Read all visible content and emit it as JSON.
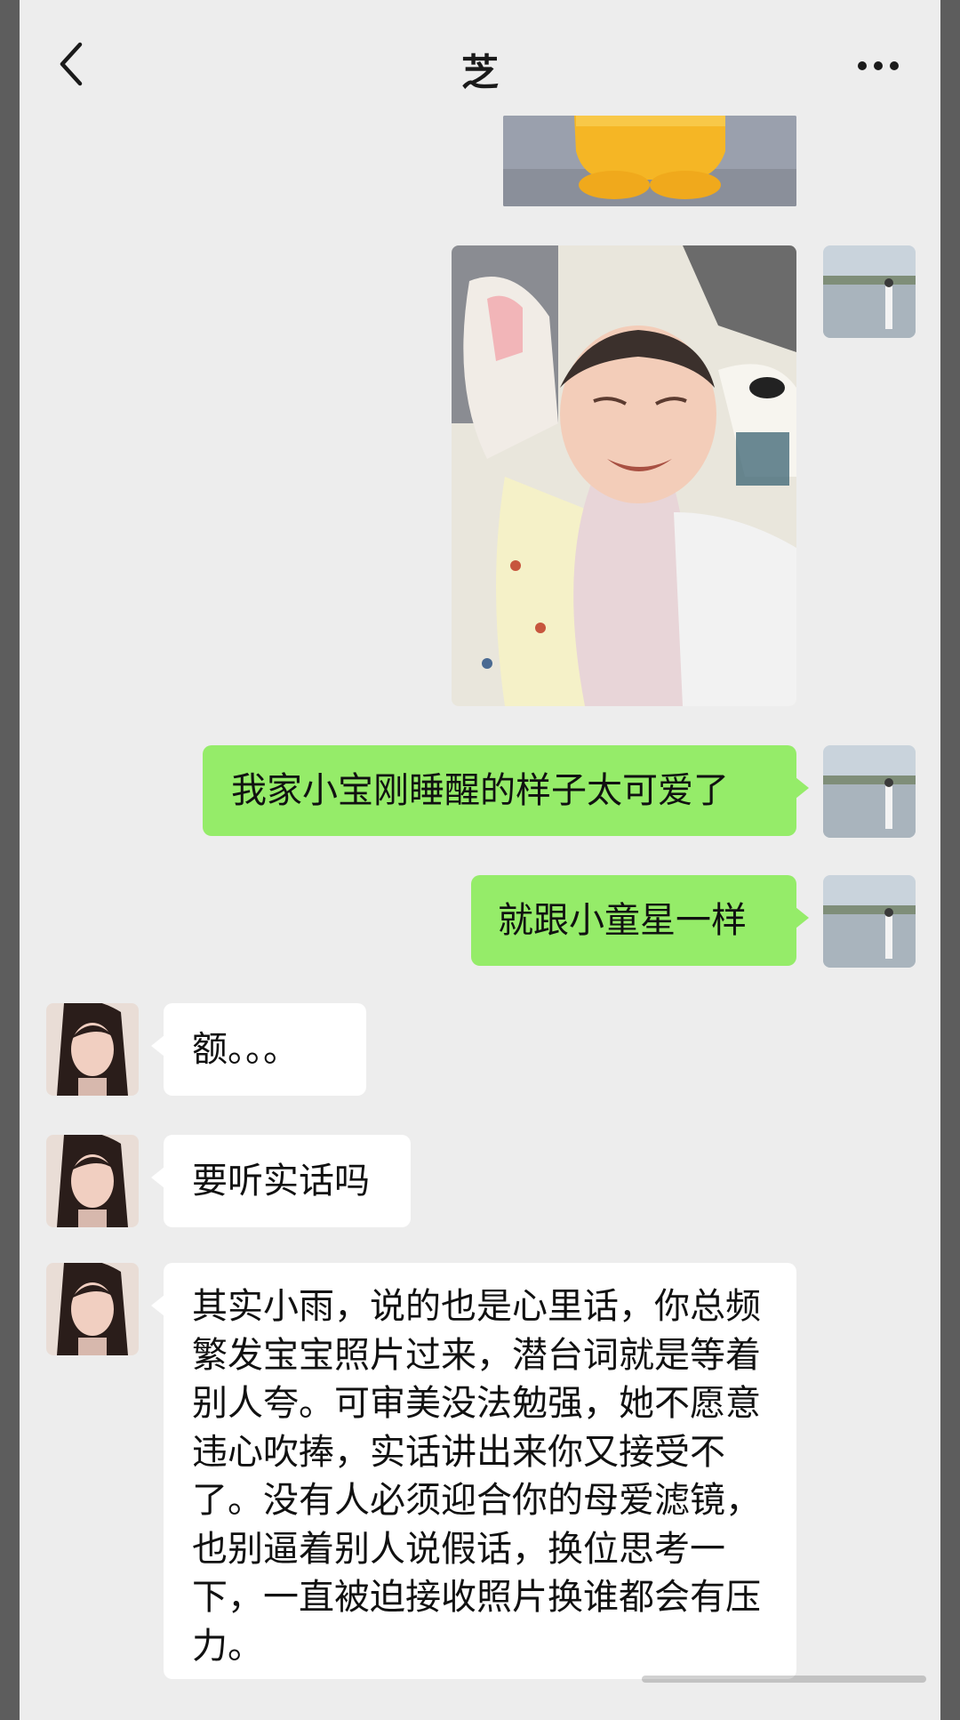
{
  "header": {
    "title": "芝",
    "back_icon": "chevron-left-icon",
    "more_icon": "ellipsis-icon"
  },
  "messages": [
    {
      "side": "right",
      "type": "image",
      "content": "partial-image"
    },
    {
      "side": "right",
      "type": "image",
      "content": "baby-photo"
    },
    {
      "side": "right",
      "type": "text",
      "text": "我家小宝刚睡醒的样子太可爱了"
    },
    {
      "side": "right",
      "type": "text",
      "text": "就跟小童星一样"
    },
    {
      "side": "left",
      "type": "text",
      "text": "额。。。"
    },
    {
      "side": "left",
      "type": "text",
      "text": "要听实话吗"
    },
    {
      "side": "left",
      "type": "text",
      "text": "其实小雨，说的也是心里话，你总频繁发宝宝照片过来，潜台词就是等着别人夸。可审美没法勉强，她不愿意违心吹捧，实话讲出来你又接受不了。没有人必须迎合你的母爱滤镜，也别逼着别人说假话，换位思考一下，一直被迫接收照片换谁都会有压力。"
    }
  ],
  "colors": {
    "sent_bubble": "#95ec69",
    "received_bubble": "#ffffff",
    "background": "#ededed"
  }
}
